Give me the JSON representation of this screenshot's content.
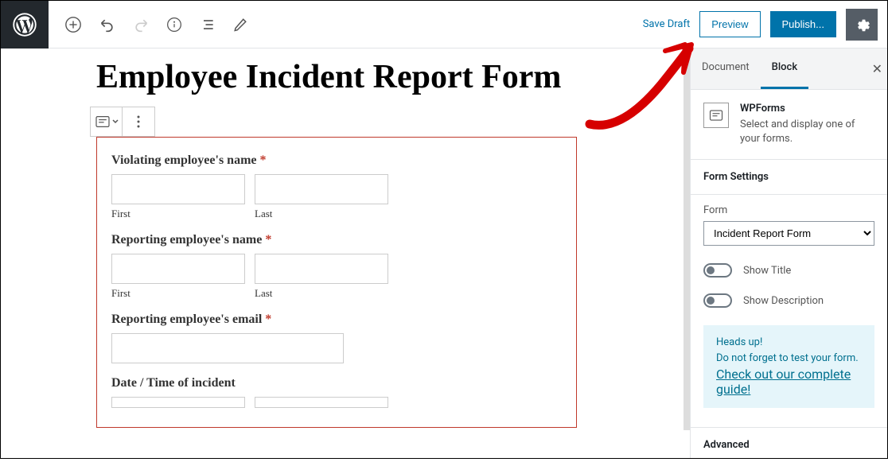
{
  "toolbar": {
    "save_draft": "Save Draft",
    "preview": "Preview",
    "publish": "Publish..."
  },
  "page_title": "Employee Incident Report Form",
  "form": {
    "field1": {
      "label": "Violating employee's name",
      "required": "*",
      "sub_first": "First",
      "sub_last": "Last"
    },
    "field2": {
      "label": "Reporting employee's name",
      "required": "*",
      "sub_first": "First",
      "sub_last": "Last"
    },
    "field3": {
      "label": "Reporting employee's email",
      "required": "*"
    },
    "field4": {
      "label": "Date / Time of incident"
    }
  },
  "sidebar": {
    "tab_document": "Document",
    "tab_block": "Block",
    "block_name": "WPForms",
    "block_desc": "Select and display one of your forms.",
    "form_settings_header": "Form Settings",
    "form_label": "Form",
    "form_selected": "Incident Report Form",
    "toggle_title": "Show Title",
    "toggle_desc": "Show Description",
    "notice_title": "Heads up!",
    "notice_text": "Do not forget to test your form.",
    "notice_link": "Check out our complete guide!",
    "advanced_header": "Advanced"
  }
}
